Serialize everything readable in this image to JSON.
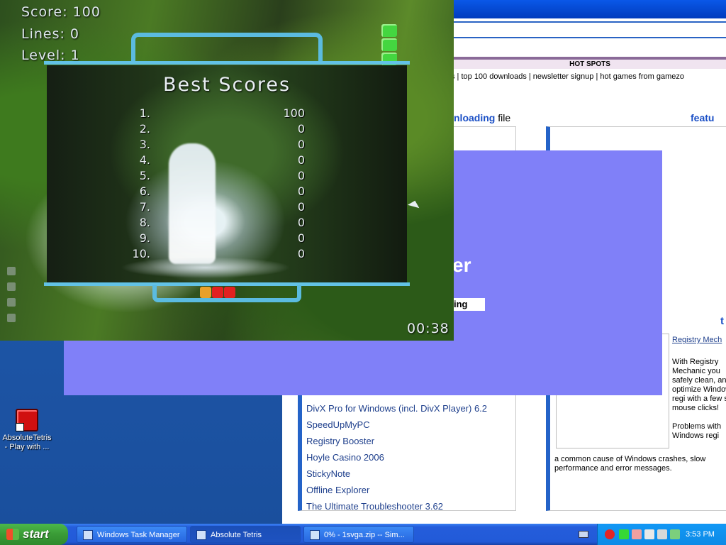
{
  "game": {
    "score_label": "Score: 100",
    "lines_label": "Lines:  0",
    "level_label": "Level:  1",
    "best_scores_title": "Best Scores",
    "scores": [
      {
        "rank": "1.",
        "value": "100"
      },
      {
        "rank": "2.",
        "value": "0"
      },
      {
        "rank": "3.",
        "value": "0"
      },
      {
        "rank": "4.",
        "value": "0"
      },
      {
        "rank": "5.",
        "value": "0"
      },
      {
        "rank": "6.",
        "value": "0"
      },
      {
        "rank": "7.",
        "value": "0"
      },
      {
        "rank": "8.",
        "value": "0"
      },
      {
        "rank": "9.",
        "value": "0"
      },
      {
        "rank": "10.",
        "value": "0"
      }
    ],
    "timer": "00:38",
    "accent_color": "#5bbbe0"
  },
  "desktop_icon": {
    "label": "AbsoluteTetris - Play with ..."
  },
  "browser": {
    "hot_spots": "HOT SPOTS",
    "links": "s | top 100 downloads | newsletter signup | hot games from gamezo",
    "left_heading_bold": "nloading",
    "left_heading_rest": " file",
    "right_heading": "featu",
    "downloads": [
      "DivX Pro for Windows (incl. DivX Player) 6.2",
      "SpeedUpMyPC",
      "Registry Booster",
      "Hoyle Casino 2006",
      "StickyNote",
      "Offline Explorer",
      "The Ultimate Troubleshooter 3.62"
    ],
    "reg_title": "Registry Mech",
    "reg_text": "With Registry Mechanic you safely clean, and optimize Windows regi with a few sin mouse clicks!",
    "reg_text2": "Problems with Windows regi",
    "reg_bottom": "a common cause of Windows crashes, slow performance and error messages.",
    "t_letter": "t"
  },
  "overlay": {
    "big_text": "er",
    "mini_text": "ing"
  },
  "taskbar": {
    "start_label": "start",
    "tasks": [
      "Windows Task Manager",
      "Absolute Tetris",
      "0% - 1svga.zip -- Sim..."
    ],
    "clock": "3:53 PM"
  }
}
